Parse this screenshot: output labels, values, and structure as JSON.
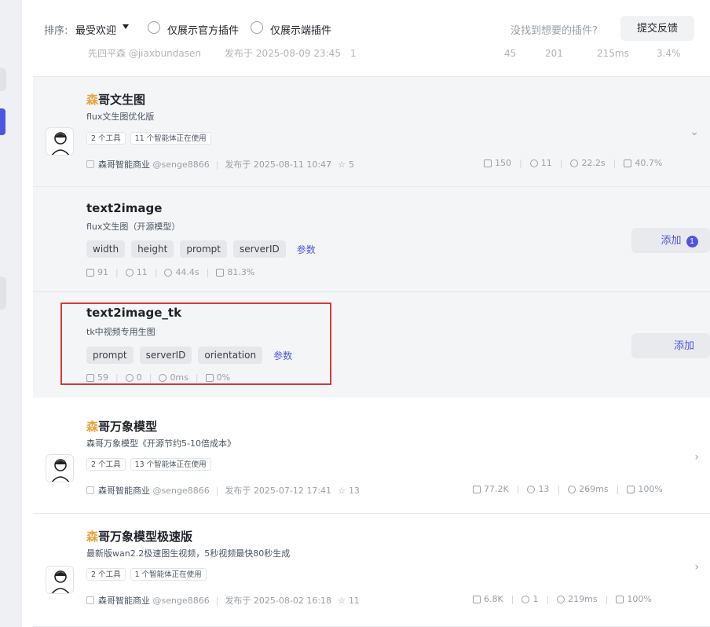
{
  "filter": {
    "sort_label": "排序:",
    "sort_value": "最受欢迎",
    "official_only": "仅展示官方插件",
    "client_only": "仅展示端插件",
    "hint": "没找到想要的插件?",
    "feedback": "提交反馈"
  },
  "cut_row": {
    "author": "先四平森 @jiaxbundasen",
    "published": "发布于 2025-08-09 23:45",
    "stars": "1",
    "s1": "45",
    "s2": "201",
    "s3": "215ms",
    "s4": "3.4%"
  },
  "card1": {
    "title_hl": "森",
    "title_rest": "哥文生图",
    "desc": "flux文生图优化版",
    "badge_tools": "2 个工具",
    "badge_agents": "11 个智能体正在使用",
    "author": "森哥智能商业",
    "handle": "@senge8866",
    "published": "发布于 2025-08-11 10:47",
    "stars": "5",
    "s1": "150",
    "s2": "11",
    "s3": "22.2s",
    "s4": "40.7%"
  },
  "tool1": {
    "name": "text2image",
    "desc": "flux文生图（开源模型）",
    "params": [
      "width",
      "height",
      "prompt",
      "serverID"
    ],
    "params_link": "参数",
    "s1": "91",
    "s2": "11",
    "s3": "44.4s",
    "s4": "81.3%",
    "add": "添加",
    "add_count": "1"
  },
  "tool2": {
    "name": "text2image_tk",
    "desc": "tk中视频专用生图",
    "params": [
      "prompt",
      "serverID",
      "orientation"
    ],
    "params_link": "参数",
    "s1": "59",
    "s2": "0",
    "s3": "0ms",
    "s4": "0%",
    "add": "添加"
  },
  "card2": {
    "title_hl": "森",
    "title_rest": "哥万象模型",
    "desc": "森哥万象模型《开源节约5-10倍成本》",
    "badge_tools": "2 个工具",
    "badge_agents": "13 个智能体正在使用",
    "author": "森哥智能商业",
    "handle": "@senge8866",
    "published": "发布于 2025-07-12 17:41",
    "stars": "13",
    "s1": "77.2K",
    "s2": "13",
    "s3": "269ms",
    "s4": "100%"
  },
  "card3": {
    "title_hl": "森",
    "title_rest": "哥万象模型极速版",
    "desc": "最新版wan2.2极速图生视频，5秒视频最快80秒生成",
    "badge_tools": "2 个工具",
    "badge_agents": "1 个智能体正在使用",
    "author": "森哥智能商业",
    "handle": "@senge8866",
    "published": "发布于 2025-08-02 16:18",
    "stars": "11",
    "s1": "6.8K",
    "s2": "1",
    "s3": "219ms",
    "s4": "100%"
  },
  "colors": {
    "accent": "#4e55e0",
    "title_highlight": "#e9a23b",
    "annotation_box": "#d43a3a"
  }
}
